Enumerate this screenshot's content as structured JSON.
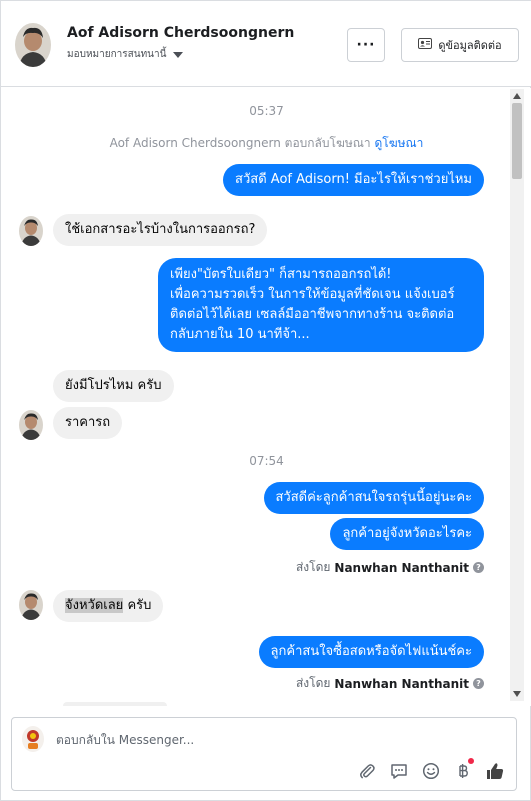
{
  "header": {
    "name": "Aof Adisorn Cherdsoongnern",
    "assign_label": "มอบหมายการสนทนานี้",
    "more_label": "···",
    "contact_label": "ดูข้อมูลติดต่อ"
  },
  "chat": {
    "time1": "05:37",
    "system_text": "Aof Adisorn Cherdsoongnern ตอบกลับโฆษณา",
    "system_link": "ดูโฆษณา",
    "msg1": "สวัสดี Aof Adisorn! มีอะไรให้เราช่วยไหม",
    "msg2": "ใช้เอกสารอะไรบ้างในการออกรถ?",
    "msg3_lines": [
      "เพียง\"บัตรใบเดียว\" ก็สามารถออกรถได้!",
      "เพื่อความรวดเร็ว ในการให้ข้อมูลที่ชัดเจน แจ้งเบอร์",
      "ติดต่อไว้ได้เลย เซลล์มืออาชีพจากทางร้าน จะติดต่อ",
      "กลับภายใน 10 นาทีจ้า..."
    ],
    "msg4": "ยังมีโปรไหม ครับ",
    "msg5": "ราคารถ",
    "time2": "07:54",
    "msg6": "สวัสดีค่ะลูกค้าสนใจรถรุ่นนี้อยู่นะคะ",
    "msg7": "ลูกค้าอยู่จังหวัดอะไรคะ",
    "sent_by_prefix": "ส่งโดย",
    "sent_by_name": "Nanwhan Nanthanit",
    "msg8_highlight": "จังหวัดเลย",
    "msg8_rest": " ครับ",
    "msg9": "ลูกค้าสนใจซื้อสดหรือจัดไฟแน้นช์คะ"
  },
  "composer": {
    "placeholder": "ตอบกลับใน Messenger..."
  },
  "colors": {
    "bubble_out": "#0a7cff",
    "bubble_in": "#f0f0f0",
    "link": "#1877f2",
    "notification_dot": "#f02849"
  },
  "icons": {
    "more": "more-dots-icon",
    "contact": "contact-card-icon",
    "attach": "paperclip-icon",
    "chat": "chat-bubble-icon",
    "emoji": "smiley-icon",
    "payment": "baht-icon",
    "like": "thumbs-up-icon"
  }
}
